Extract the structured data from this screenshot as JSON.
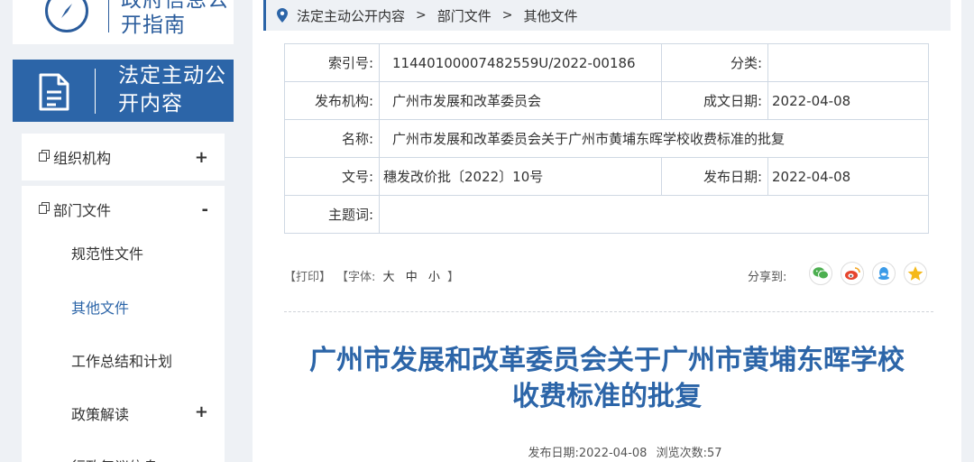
{
  "sidebar": {
    "guide_title": "政府信息公开指南",
    "public_title": "法定主动公开内容",
    "menu": {
      "org": {
        "label": "组织机构",
        "toggle": "+"
      },
      "dept": {
        "label": "部门文件",
        "toggle": "-"
      },
      "subitems": [
        {
          "label": "规范性文件"
        },
        {
          "label": "其他文件"
        },
        {
          "label": "工作总结和计划"
        },
        {
          "label": "政策解读",
          "toggle": "+"
        },
        {
          "label": "行政复议信息"
        }
      ]
    }
  },
  "breadcrumb": {
    "items": [
      "法定主动公开内容",
      "部门文件",
      "其他文件"
    ],
    "separator": ">"
  },
  "info": {
    "index_label": "索引号:",
    "index_value": "11440100007482559U/2022-00186",
    "category_label": "分类:",
    "category_value": "",
    "publisher_label": "发布机构:",
    "publisher_value": "广州市发展和改革委员会",
    "written_date_label": "成文日期:",
    "written_date_value": "2022-04-08",
    "name_label": "名称:",
    "name_value": "广州市发展和改革委员会关于广州市黄埔东晖学校收费标准的批复",
    "docno_label": "文号:",
    "docno_value": "穗发改价批〔2022〕10号",
    "pub_date_label": "发布日期:",
    "pub_date_value": "2022-04-08",
    "subject_label": "主题词:",
    "subject_value": ""
  },
  "toolbar": {
    "print": "【打印】",
    "font_prefix": "【字体:",
    "font_large": "大",
    "font_medium": "中",
    "font_small": "小",
    "font_suffix": "】",
    "share_label": "分享到:"
  },
  "article": {
    "title_line1": "广州市发展和改革委员会关于广州市黄埔东晖学校",
    "title_line2": "收费标准的批复",
    "meta_date_label": "发布日期:",
    "meta_date": "2022-04-08",
    "meta_views_label": "浏览次数:",
    "meta_views": "57"
  },
  "colors": {
    "brand_blue": "#2c65a8",
    "wechat": "#4caf50",
    "weibo": "#e6452d",
    "qq": "#3b9be8",
    "qzone": "#f5b919"
  },
  "icons": {
    "guide": "compass-icon",
    "public": "document-icon",
    "breadcrumb": "location-pin-icon",
    "menu_item": "copy-icon",
    "share": [
      "wechat-icon",
      "weibo-icon",
      "qq-icon",
      "qzone-icon"
    ]
  }
}
